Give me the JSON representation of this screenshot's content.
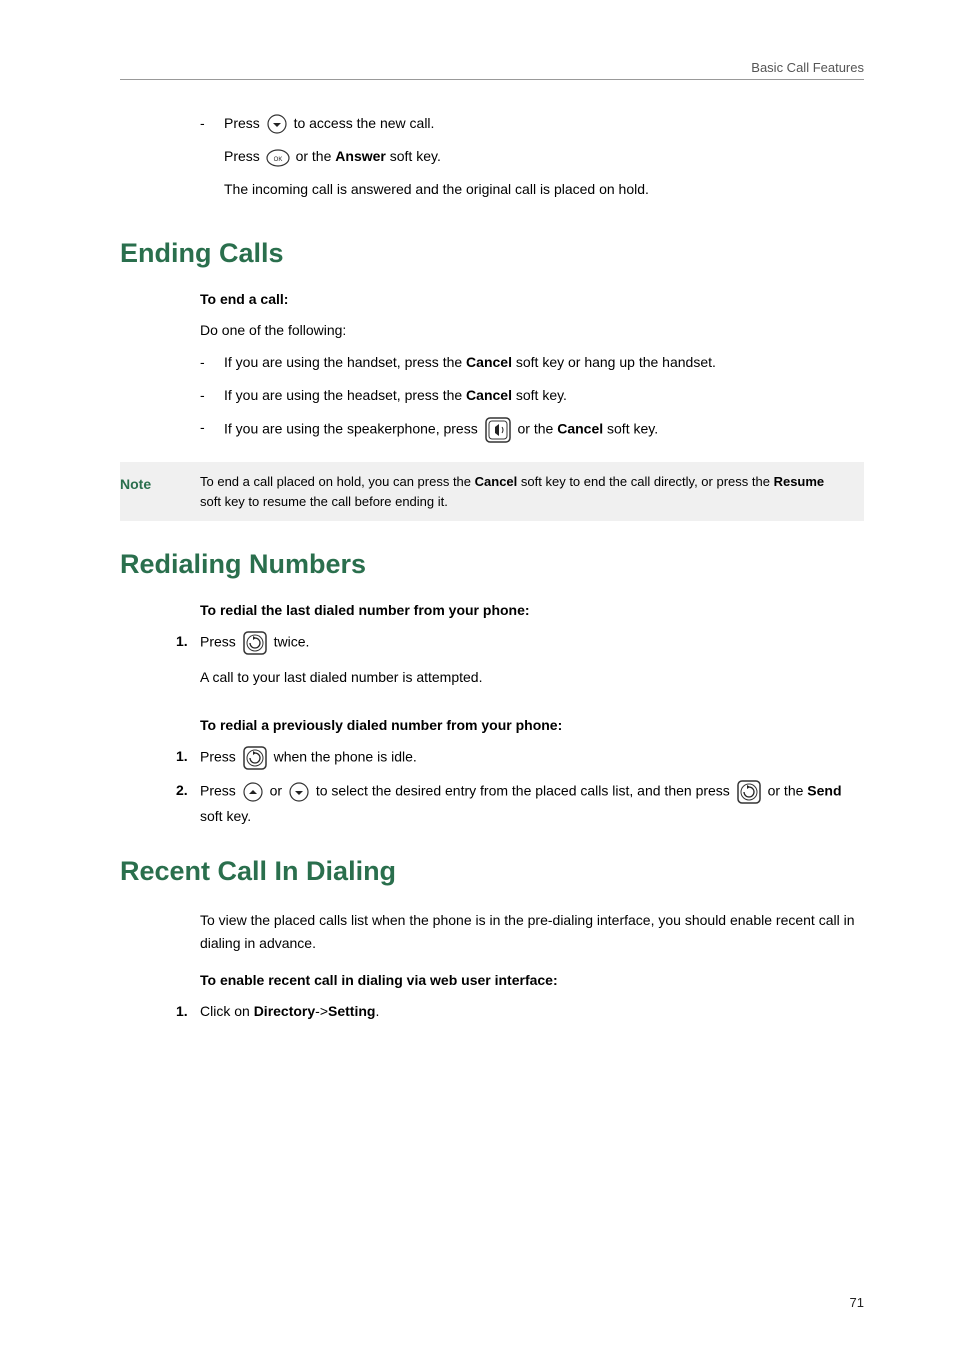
{
  "header": {
    "running_title": "Basic Call Features"
  },
  "footer": {
    "page_number": "71"
  },
  "top": {
    "line1_pre": "Press",
    "line1_post": "to access the new call.",
    "line2_pre": "Press",
    "line2_mid": "or the",
    "line2_bold": "Answer",
    "line2_post": "soft key.",
    "line3": "The incoming call is answered and the original call is placed on hold."
  },
  "ending": {
    "heading": "Ending Calls",
    "subhead": "To end a call:",
    "intro": "Do one of the following:",
    "bullet1_pre": "If you are using the handset, press the",
    "bullet1_bold": "Cancel",
    "bullet1_post": "soft key or hang up the handset.",
    "bullet2_pre": "If you are using the headset, press the",
    "bullet2_bold": "Cancel",
    "bullet2_post": "soft key.",
    "bullet3_pre": "If you are using the speakerphone, press",
    "bullet3_mid": "or the",
    "bullet3_bold": "Cancel",
    "bullet3_post": "soft key."
  },
  "note": {
    "label": "Note",
    "text_pre": "To end a call placed on hold, you can press the",
    "text_bold1": "Cancel",
    "text_mid": "soft key to end the call directly, or press the",
    "text_bold2": "Resume",
    "text_post": "soft key to resume the call before ending it."
  },
  "redial": {
    "heading": "Redialing Numbers",
    "subhead1": "To redial the last dialed number from your phone:",
    "step1_num": "1.",
    "step1_pre": "Press",
    "step1_post": "twice.",
    "step1_sub": "A call to your last dialed number is attempted.",
    "subhead2": "To redial a previously dialed number from your phone:",
    "step2a_num": "1.",
    "step2a_pre": "Press",
    "step2a_post": "when the phone is idle.",
    "step2b_num": "2.",
    "step2b_pre": "Press",
    "step2b_or": "or",
    "step2b_mid": "to select the desired entry from the placed calls list, and then press",
    "step2b_mid2": "or the",
    "step2b_bold": "Send",
    "step2b_post": "soft key."
  },
  "recent": {
    "heading": "Recent Call In Dialing",
    "intro": "To view the placed calls list when the phone is in the pre-dialing interface, you should enable recent call in dialing in advance.",
    "subhead": "To enable recent call in dialing via web user interface:",
    "step1_num": "1.",
    "step1_pre": "Click on",
    "step1_bold1": "Directory",
    "step1_sep": "->",
    "step1_bold2": "Setting",
    "step1_post": "."
  }
}
